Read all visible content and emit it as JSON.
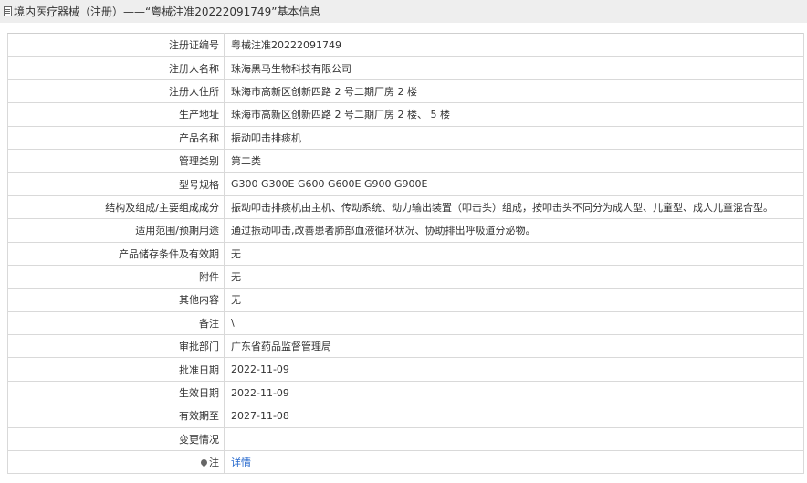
{
  "header": {
    "title": "境内医疗器械（注册）——“粤械注准20222091749”基本信息"
  },
  "rows": [
    {
      "label": "注册证编号",
      "value": "粤械注准20222091749"
    },
    {
      "label": "注册人名称",
      "value": "珠海黑马生物科技有限公司"
    },
    {
      "label": "注册人住所",
      "value": "珠海市高新区创新四路 2 号二期厂房 2 楼"
    },
    {
      "label": "生产地址",
      "value": "珠海市高新区创新四路 2 号二期厂房 2 楼、 5 楼"
    },
    {
      "label": "产品名称",
      "value": "振动叩击排痰机"
    },
    {
      "label": "管理类别",
      "value": "第二类"
    },
    {
      "label": "型号规格",
      "value": "G300 G300E G600 G600E G900 G900E"
    },
    {
      "label": "结构及组成/主要组成成分",
      "value": "振动叩击排痰机由主机、传动系统、动力输出装置（叩击头）组成，按叩击头不同分为成人型、儿童型、成人儿童混合型。"
    },
    {
      "label": "适用范围/预期用途",
      "value": "通过振动叩击,改善患者肺部血液循环状况、协助排出呼吸道分泌物。"
    },
    {
      "label": "产品储存条件及有效期",
      "value": "无"
    },
    {
      "label": "附件",
      "value": "无"
    },
    {
      "label": "其他内容",
      "value": "无"
    },
    {
      "label": "备注",
      "value": "\\"
    },
    {
      "label": "审批部门",
      "value": "广东省药品监督管理局"
    },
    {
      "label": "批准日期",
      "value": "2022-11-09"
    },
    {
      "label": "生效日期",
      "value": "2022-11-09"
    },
    {
      "label": "有效期至",
      "value": "2027-11-08"
    },
    {
      "label": "变更情况",
      "value": ""
    }
  ],
  "note_row": {
    "label": "注",
    "link_text": "详情",
    "icon": "pin-icon"
  }
}
